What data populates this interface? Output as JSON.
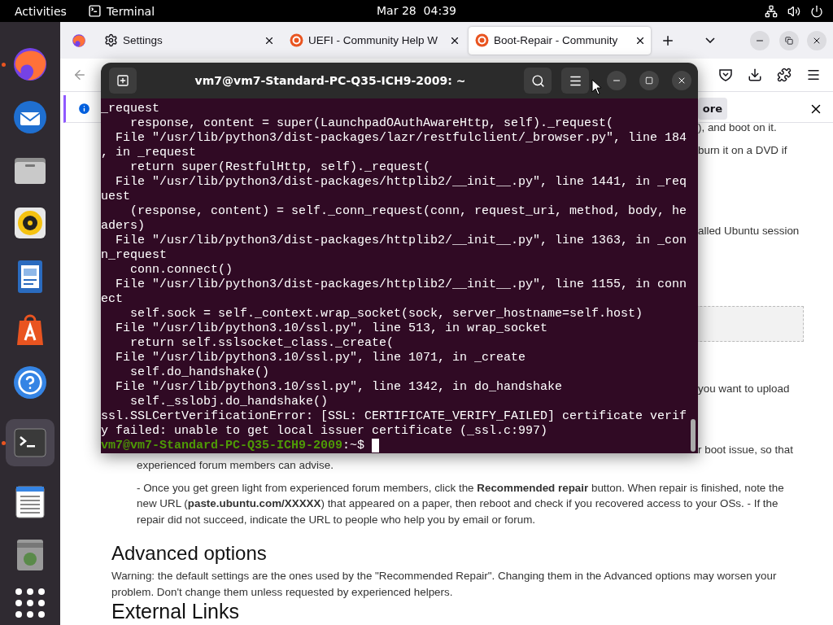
{
  "top_bar": {
    "activities": "Activities",
    "app_name": "Terminal",
    "clock": "Mar 28  04:39"
  },
  "dock": [
    {
      "kind": "firefox",
      "running": true,
      "selected": false
    },
    {
      "kind": "mail",
      "running": false,
      "selected": false
    },
    {
      "kind": "files",
      "running": false,
      "selected": false
    },
    {
      "kind": "music",
      "running": false,
      "selected": false
    },
    {
      "kind": "writer",
      "running": false,
      "selected": false
    },
    {
      "kind": "store",
      "running": false,
      "selected": false
    },
    {
      "kind": "help",
      "running": false,
      "selected": false
    },
    {
      "kind": "terminal",
      "running": true,
      "selected": true
    },
    {
      "kind": "editor",
      "running": false,
      "selected": false
    },
    {
      "kind": "disk",
      "running": false,
      "selected": false
    },
    {
      "kind": "apps",
      "running": false,
      "selected": false
    }
  ],
  "browser": {
    "tabs": [
      {
        "label": "Settings",
        "kind": "settings",
        "selected": false
      },
      {
        "label": "UEFI - Community Help W",
        "kind": "web",
        "selected": false
      },
      {
        "label": "Boot-Repair - Community",
        "kind": "web",
        "selected": true
      }
    ],
    "notification": {
      "button": "ore"
    },
    "content": [
      {
        "kind": "clipped",
        "text": "), and boot on it."
      },
      {
        "kind": "clipped",
        "text": "burn it on a DVD if"
      },
      {
        "kind": "clipped",
        "text": "alled Ubuntu session"
      },
      {
        "kind": "code_box"
      },
      {
        "kind": "clipped",
        "text": "you want to upload"
      },
      {
        "kind": "clipped",
        "text": "r boot issue, so that"
      },
      {
        "kind": "indented",
        "text": "experienced forum members can advise."
      },
      {
        "kind": "indented",
        "text": "- Once you get green light from experienced forum members, click the **Recommended repair** button. When repair is finished, note the new URL (**paste.ubuntu.com/XXXXX**) that appeared on a paper, then reboot and check if you recovered access to your OSs. - If the repair did not succeed, indicate the URL to people who help you by email or forum."
      },
      {
        "kind": "heading",
        "text": "Advanced options"
      },
      {
        "kind": "body",
        "text": "Warning: the default settings are the ones used by the \"Recommended Repair\". Changing them in the Advanced options may worsen your problem. Don't change them unless requested by experienced helpers."
      },
      {
        "kind": "heading_large",
        "text": "External Links"
      }
    ]
  },
  "terminal": {
    "title": "vm7@vm7-Standard-PC-Q35-ICH9-2009: ~",
    "lines": [
      "_request",
      "    response, content = super(LaunchpadOAuthAwareHttp, self)._request(",
      "  File \"/usr/lib/python3/dist-packages/lazr/restfulclient/_browser.py\", line 184",
      ", in _request",
      "    return super(RestfulHttp, self)._request(",
      "  File \"/usr/lib/python3/dist-packages/httplib2/__init__.py\", line 1441, in _req",
      "uest",
      "    (response, content) = self._conn_request(conn, request_uri, method, body, he",
      "aders)",
      "  File \"/usr/lib/python3/dist-packages/httplib2/__init__.py\", line 1363, in _con",
      "n_request",
      "    conn.connect()",
      "  File \"/usr/lib/python3/dist-packages/httplib2/__init__.py\", line 1155, in conn",
      "ect",
      "    self.sock = self._context.wrap_socket(sock, server_hostname=self.host)",
      "  File \"/usr/lib/python3.10/ssl.py\", line 513, in wrap_socket",
      "    return self.sslsocket_class._create(",
      "  File \"/usr/lib/python3.10/ssl.py\", line 1071, in _create",
      "    self.do_handshake()",
      "  File \"/usr/lib/python3.10/ssl.py\", line 1342, in do_handshake",
      "    self._sslobj.do_handshake()",
      "ssl.SSLCertVerificationError: [SSL: CERTIFICATE_VERIFY_FAILED] certificate verif",
      "y failed: unable to get local issuer certificate (_ssl.c:997)"
    ],
    "prompt": {
      "user": "vm7@vm7-Standard-PC-Q35-ICH9-2009",
      "path": ":~$ "
    }
  }
}
